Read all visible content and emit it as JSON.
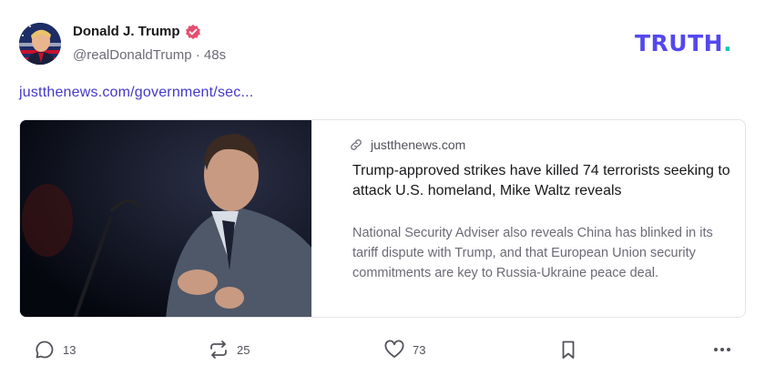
{
  "author": {
    "name": "Donald J. Trump",
    "handle": "@realDonaldTrump",
    "separator": "·",
    "time": "48s",
    "verified_color": "#e3506f"
  },
  "brand": {
    "logo_main": "TRUTH",
    "logo_dot": ".",
    "primary_color": "#5448ee",
    "accent_color": "#12c6b4"
  },
  "post": {
    "link_text": "justthenews.com/government/sec...",
    "link_color": "#4338ca"
  },
  "card": {
    "domain": "justthenews.com",
    "title": "Trump-approved strikes have killed 74 terrorists seeking to attack U.S. homeland, Mike Waltz reveals",
    "description": "National Security Adviser also reveals China has blinked in its tariff dispute with Trump, and that European Union security commitments are key to Russia-Ukraine peace deal."
  },
  "actions": {
    "replies": "13",
    "retruths": "25",
    "likes": "73"
  },
  "icons": {
    "reply": "speech-bubble-icon",
    "retruth": "repost-arrows-icon",
    "like": "heart-icon",
    "bookmark": "bookmark-icon",
    "more": "ellipsis-icon",
    "link": "chain-link-icon",
    "verified": "verified-badge-icon"
  }
}
